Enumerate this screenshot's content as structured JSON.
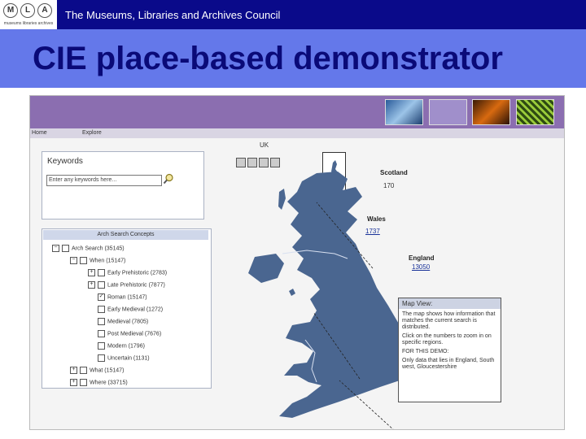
{
  "header": {
    "logo_letters": [
      "M",
      "L",
      "A"
    ],
    "logo_tagline": "museums libraries archives",
    "council_name": "The Museums, Libraries and Archives Council",
    "slide_title": "CIE place-based demonstrator"
  },
  "colors": {
    "top_bar": "#0a0a8a",
    "title_bar": "#6478ea",
    "title_text": "#0a0a78",
    "app_banner": "#8b6eb0",
    "map_land": "#4a6690"
  },
  "app": {
    "nav": {
      "home": "Home",
      "explore": "Explore"
    },
    "keywords": {
      "title": "Keywords",
      "input_value": "Enter any keywords here...",
      "search_icon": "magnifier-icon"
    },
    "concepts": {
      "title": "Arch Search Concepts",
      "tree": [
        {
          "label": "Arch Search (35145)",
          "toggle": "−",
          "checked": false
        },
        {
          "label": "When (15147)",
          "toggle": "−",
          "checked": false
        },
        {
          "label": "Early Prehistoric (2783)",
          "toggle": "+",
          "checked": false
        },
        {
          "label": "Late Prehistoric (7877)",
          "toggle": "+",
          "checked": false
        },
        {
          "label": "Roman (15147)",
          "toggle": "",
          "checked": true
        },
        {
          "label": "Early Medieval (1272)",
          "toggle": "",
          "checked": false
        },
        {
          "label": "Medieval (7805)",
          "toggle": "",
          "checked": false
        },
        {
          "label": "Post Medieval (7676)",
          "toggle": "",
          "checked": false
        },
        {
          "label": "Modern (1796)",
          "toggle": "",
          "checked": false
        },
        {
          "label": "Uncertain (1131)",
          "toggle": "",
          "checked": false
        },
        {
          "label": "What (15147)",
          "toggle": "+",
          "checked": false
        },
        {
          "label": "Where (33715)",
          "toggle": "+",
          "checked": false
        }
      ]
    },
    "map": {
      "country_label": "UK",
      "tool_icons": [
        "save-icon",
        "print-icon",
        "zoom-icon",
        "pan-icon"
      ],
      "regions": [
        {
          "name": "Scotland",
          "count": "170"
        },
        {
          "name": "Wales",
          "count": "1737"
        },
        {
          "name": "England",
          "count": "13050"
        }
      ]
    },
    "map_view": {
      "title": "Map View:",
      "lines": [
        "The map shows how information that matches the current search is distributed.",
        "Click on the numbers to zoom in on specific regions.",
        "FOR THIS DEMO:",
        "Only data that lies in England, South west, Gloucestershire"
      ]
    }
  }
}
